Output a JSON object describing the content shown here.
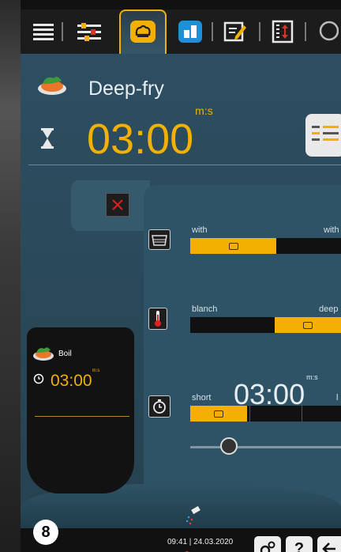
{
  "toolbar": {
    "buttons": [
      "menu-icon",
      "sliders-icon",
      "food-icon",
      "layout-icon",
      "edit-icon",
      "exchange-icon",
      "search-icon"
    ],
    "active_index": 2
  },
  "header": {
    "program_name": "Deep-fry",
    "timer": "03:00",
    "timer_unit": "m:s"
  },
  "steps": {
    "fat": {
      "left_label": "with",
      "right_label": "with"
    },
    "temperature": {
      "left_label": "blanch",
      "right_label": "deep"
    },
    "time": {
      "left_label": "short",
      "right_label": "l",
      "timer": "03:00",
      "timer_unit": "m:s"
    }
  },
  "preview": {
    "name": "Boil",
    "timer": "03:00",
    "timer_unit": "m:s"
  },
  "status": {
    "badge": "8",
    "datetime": "09:41 | 24.03.2020",
    "help_label": "?"
  },
  "colors": {
    "accent": "#f3b000",
    "panel": "#2e5366",
    "background": "#2b4a5c"
  }
}
